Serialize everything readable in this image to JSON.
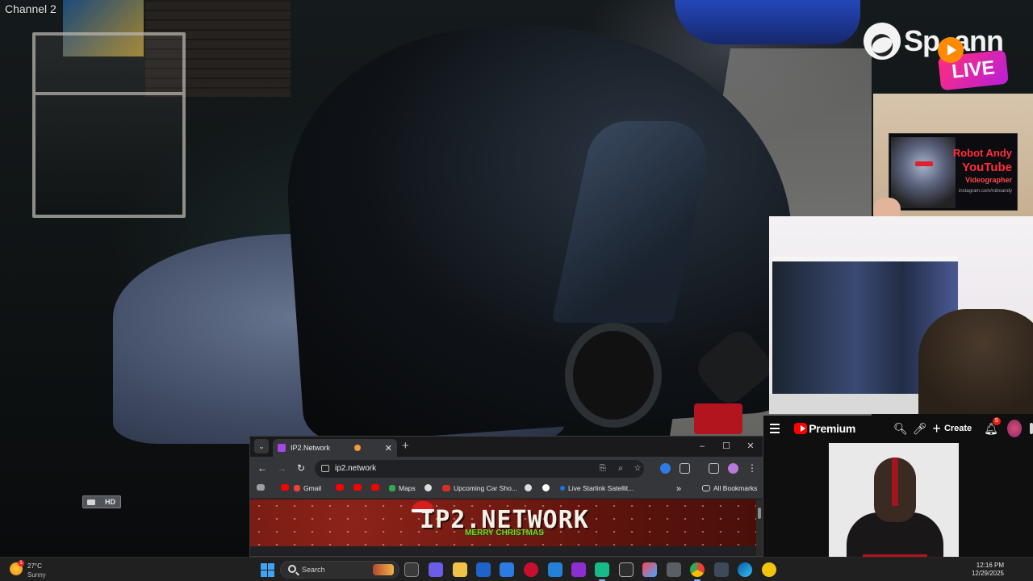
{
  "camera": {
    "channel_label": "Channel 2",
    "hd_badge": "HD"
  },
  "stream_overlay": {
    "brand_name": "Sp..ann",
    "live_label": "LIVE",
    "card": {
      "line1": "Robot Andy",
      "line2": "YouTube",
      "line3": "Videographer",
      "line4": "instagram.com/roboandy"
    }
  },
  "youtube": {
    "brand": "Premium",
    "create_label": "Create",
    "notification_count": "5"
  },
  "browser": {
    "tab_title": "IP2.Network",
    "address": "ip2.network",
    "bookmarks": [
      "Gmail",
      "Maps",
      "Upcoming Car Sho...",
      "Live Starlink Satellit..."
    ],
    "all_bookmarks_label": "All Bookmarks",
    "page_title": "IP2.NETWORK",
    "page_subtitle": "MERRY CHRISTMAS"
  },
  "taskbar": {
    "weather_temp": "27°C",
    "weather_condition": "Sunny",
    "weather_alert": "1",
    "search_placeholder": "Search",
    "time": "12:16 PM",
    "date": "12/29/2025"
  },
  "colors": {
    "youtube_red": "#ff0000",
    "live_pink": "#ff2d7c",
    "banner_red": "#8d2318",
    "accent_blue": "#3ea3f3"
  }
}
